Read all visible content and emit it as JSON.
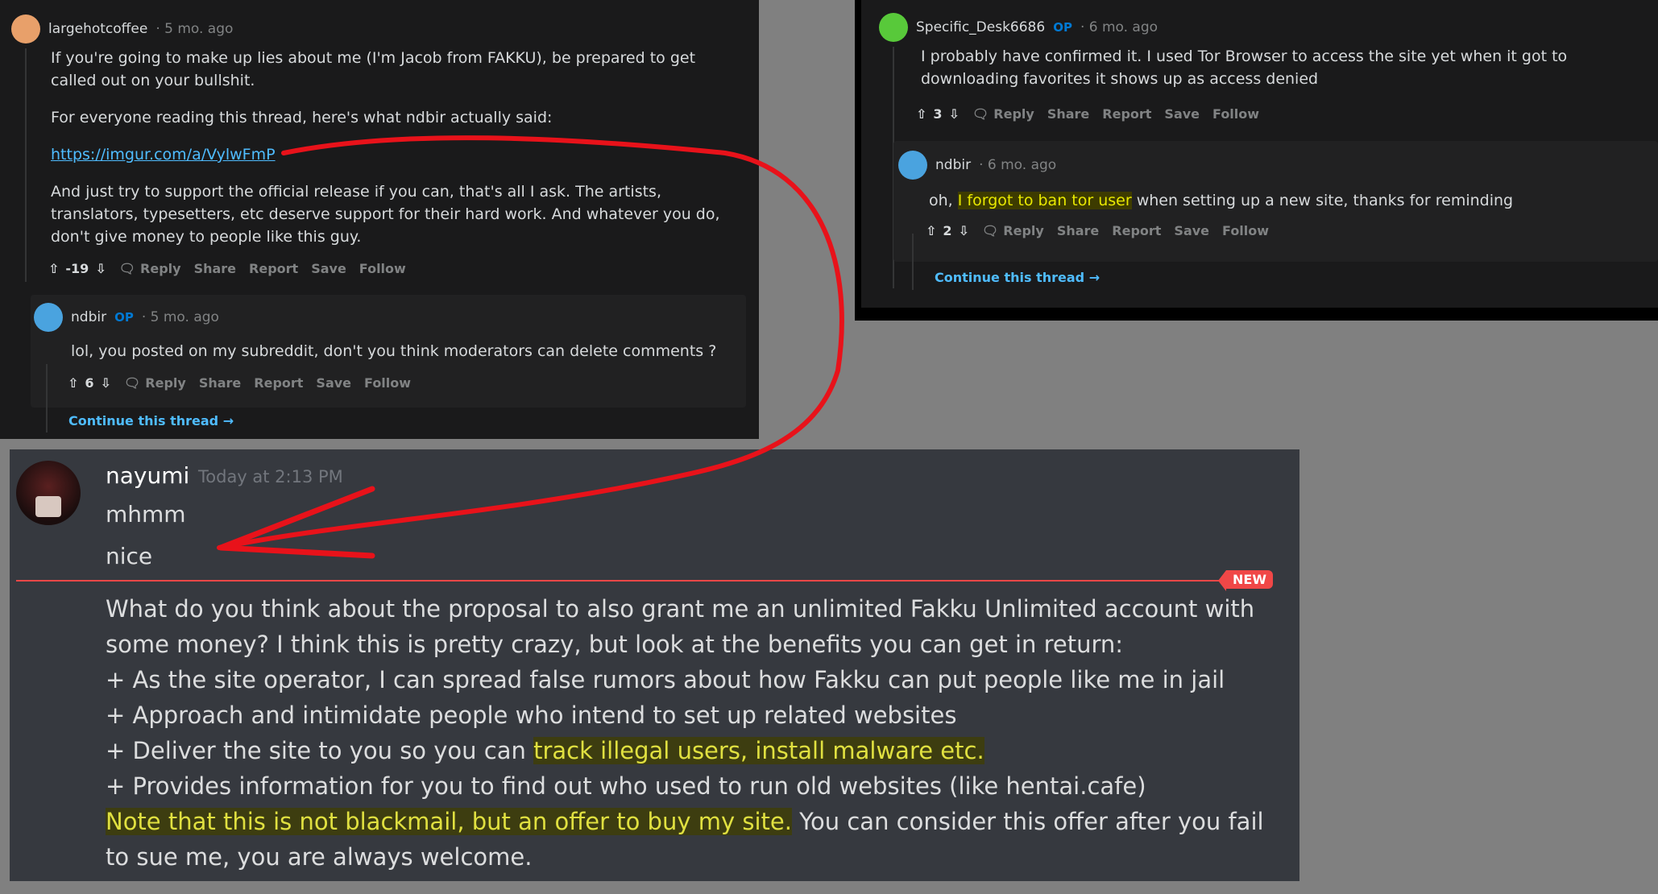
{
  "left": {
    "comment": {
      "username": "largehotcoffee",
      "time": "· 5 mo. ago",
      "para1": "If you're going to make up lies about me (I'm Jacob from FAKKU), be prepared to get called out on your bullshit.",
      "para2": "For everyone reading this thread, here's what ndbir actually said:",
      "link": "https://imgur.com/a/VylwFmP",
      "para3": "And just try to support the official release if you can, that's all I ask. The artists, translators, typesetters, etc deserve support for their hard work. And whatever you do, don't give money to people like this guy.",
      "votes": "-19"
    },
    "reply": {
      "username": "ndbir",
      "op": "OP",
      "time": "· 5 mo. ago",
      "text": "lol, you posted on my subreddit, don't you think moderators can delete comments ?",
      "votes": "6"
    },
    "continue": "Continue this thread"
  },
  "right": {
    "comment": {
      "username": "Specific_Desk6686",
      "op": "OP",
      "time": "· 6 mo. ago",
      "text": "I probably have confirmed it. I used Tor Browser to access the site yet when it got to downloading favorites it shows up as access denied",
      "votes": "3"
    },
    "reply": {
      "username": "ndbir",
      "time": "· 6 mo. ago",
      "text_pre": "oh,",
      "text_hl": "I forgot to ban tor user",
      "text_post": "when setting up a new site, thanks for reminding",
      "votes": "2"
    },
    "continue": "Continue this thread"
  },
  "actions": {
    "reply": "Reply",
    "share": "Share",
    "report": "Report",
    "save": "Save",
    "follow": "Follow"
  },
  "discord": {
    "username": "nayumi",
    "time": "Today at 2:13 PM",
    "msg1": "mhmm",
    "msg2": "nice",
    "new_label": "NEW",
    "l1": "What do you think about the proposal to also grant me an unlimited Fakku Unlimited account with some money? I think this is pretty crazy, but look at the benefits you can get in return:",
    "l2": "+ As the site operator, I can spread false rumors about how Fakku can put people like me in jail",
    "l3": "+ Approach and intimidate people who intend to set up related websites",
    "l4_pre": "+ Deliver the site to you so you can",
    "l4_hl": "track illegal users, install malware etc.",
    "l5": "+ Provides information for you to find out who used to run old websites (like hentai.cafe)",
    "l6_hl": "Note that this is not blackmail, but an offer to buy my site.",
    "l6_post": "You can consider this offer after you fail to sue me, you are always welcome."
  },
  "colors": {
    "annotation": "#e8121a",
    "highlight": "#e8e800",
    "reddit_bg": "#1a1a1b",
    "discord_bg": "#36393f",
    "link": "#4fbcff"
  }
}
